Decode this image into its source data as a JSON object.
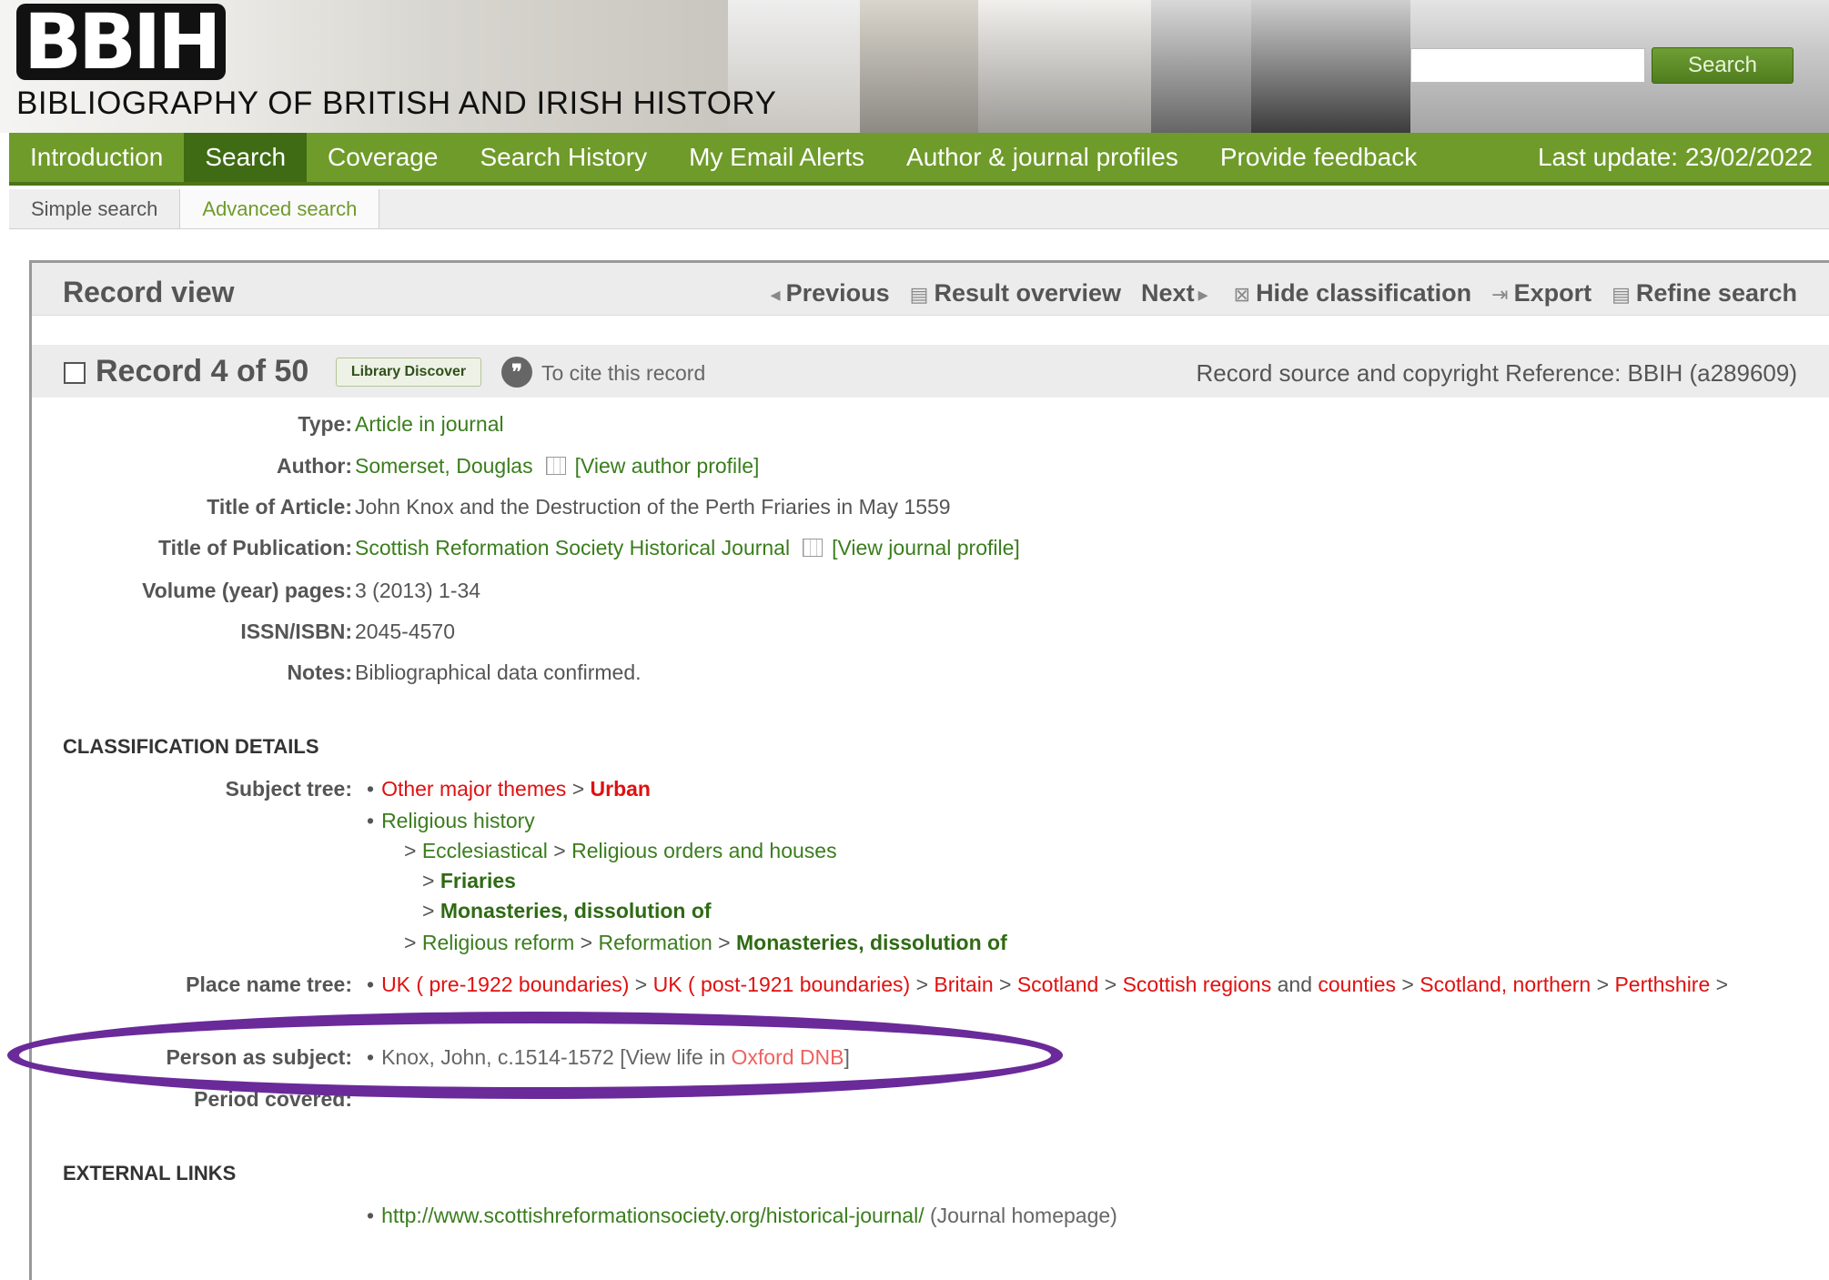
{
  "header": {
    "logo_mark": "BBIH",
    "logo_text": "BIBLIOGRAPHY OF BRITISH AND IRISH HISTORY",
    "search_placeholder": "",
    "search_button": "Search"
  },
  "nav": {
    "items": [
      "Introduction",
      "Search",
      "Coverage",
      "Search History",
      "My Email Alerts",
      "Author & journal profiles",
      "Provide feedback"
    ],
    "active": "Search",
    "last_update": "Last update: 23/02/2022"
  },
  "subnav": {
    "simple": "Simple search",
    "advanced": "Advanced search"
  },
  "record_view": {
    "title": "Record view",
    "previous": "Previous",
    "result_overview": "Result overview",
    "next": "Next",
    "hide_classification": "Hide classification",
    "export": "Export",
    "refine_search": "Refine search"
  },
  "record": {
    "title": "Record 4 of 50",
    "library_discover": "Library Discover",
    "cite": "To cite this record",
    "source": "Record source and copyright Reference: BBIH (a289609)"
  },
  "fields": {
    "type_label": "Type:",
    "type_value": "Article in journal",
    "author_label": "Author:",
    "author_value": "Somerset, Douglas",
    "author_profile": "[View author profile]",
    "title_label": "Title of Article:",
    "title_value": "John Knox and the Destruction of the Perth Friaries in May 1559",
    "pub_label": "Title of Publication:",
    "pub_value": "Scottish Reformation Society Historical Journal",
    "pub_profile": "[View journal profile]",
    "vol_label": "Volume (year) pages:",
    "vol_value": "3 (2013) 1-34",
    "issn_label": "ISSN/ISBN:",
    "issn_value": "2045-4570",
    "notes_label": "Notes:",
    "notes_value": "Bibliographical data confirmed."
  },
  "classification": {
    "heading": "CLASSIFICATION DETAILS",
    "subject_label": "Subject tree:",
    "s1a": "Other major themes",
    "s1b": "Urban",
    "s2": "Religious history",
    "s3a": "Ecclesiastical",
    "s3b": "Religious orders and houses",
    "s4": "Friaries",
    "s5": "Monasteries, dissolution of",
    "s6a": "Religious reform",
    "s6b": "Reformation",
    "s6c": "Monasteries, dissolution of",
    "place_label": "Place name tree:",
    "p1": "UK",
    "p1b": "pre-1922 boundaries)",
    "p2": "UK",
    "p2b": "post-1921 boundaries)",
    "p3": "Britain",
    "p4": "Scotland",
    "p5a": "Scottish regions",
    "p5b": "counties",
    "p6": "Scotland, northern",
    "p7": "Perthshire",
    "person_label": "Person as subject:",
    "person_value": "Knox, John, c.1514-1572",
    "person_link_pre": "[View life in",
    "person_link": "Oxford DNB",
    "period_label": "Period covered:"
  },
  "external": {
    "heading": "EXTERNAL LINKS",
    "url": "http://www.scottishreformationsociety.org/historical-journal/",
    "url_note": "(Journal homepage)"
  },
  "colors": {
    "nav_green": "#6f9b2a",
    "active_green": "#3f6b14",
    "link_red": "#e01010",
    "annotation_purple": "#6a2a9a"
  }
}
